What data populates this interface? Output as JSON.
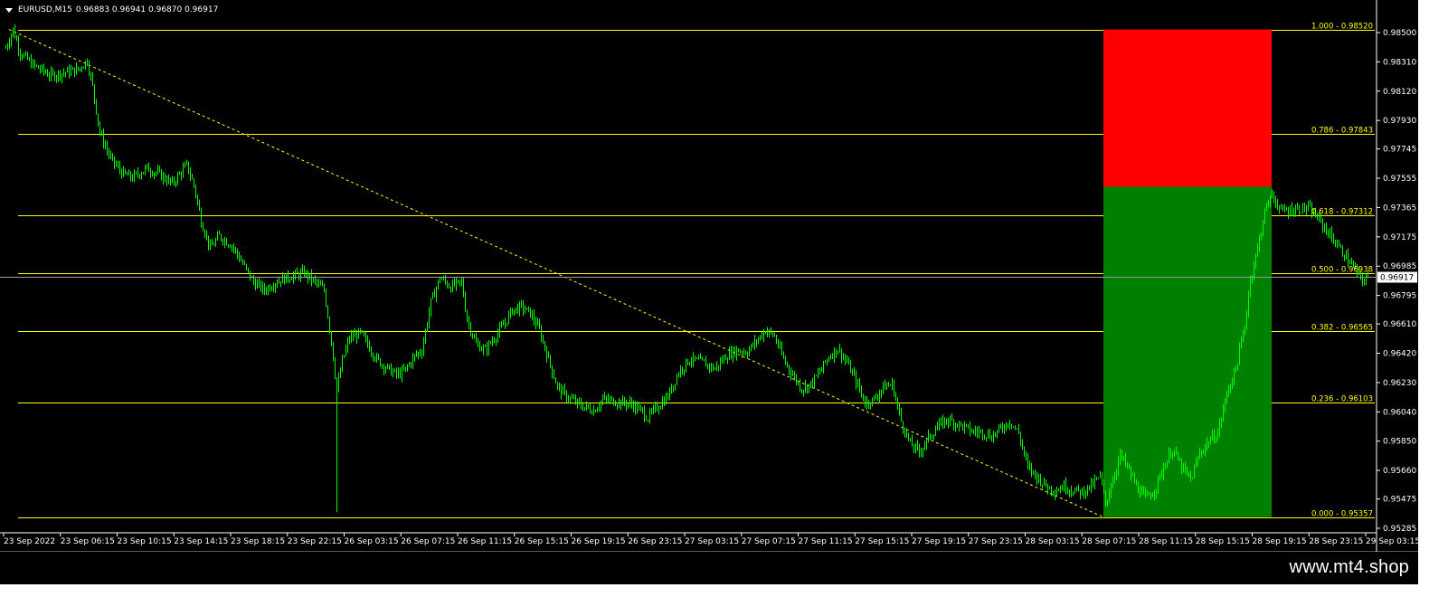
{
  "header": {
    "symbol": "EURUSD,M15",
    "ohlc": "0.96883 0.96941 0.96870 0.96917"
  },
  "watermark": "www.mt4.shop",
  "colors": {
    "background": "#000000",
    "candle": "#00ff00",
    "fib": "#ffff00",
    "stop_zone": "#ff0000",
    "target_zone": "#008000",
    "text": "#ffffff",
    "current_price_bg": "#ffffff"
  },
  "chart_data": {
    "type": "candlestick",
    "symbol": "EURUSD",
    "timeframe": "M15",
    "ylim": [
      0.95285,
      0.985
    ],
    "y_ticks": [
      "0.98500",
      "0.98310",
      "0.98120",
      "0.97930",
      "0.97745",
      "0.97555",
      "0.97365",
      "0.97175",
      "0.96985",
      "0.96795",
      "0.96610",
      "0.96420",
      "0.96230",
      "0.96040",
      "0.95850",
      "0.95660",
      "0.95475",
      "0.95285"
    ],
    "x_ticks": [
      "23 Sep 2022",
      "23 Sep 06:15",
      "23 Sep 10:15",
      "23 Sep 14:15",
      "23 Sep 18:15",
      "23 Sep 22:15",
      "26 Sep 03:15",
      "26 Sep 07:15",
      "26 Sep 11:15",
      "26 Sep 15:15",
      "26 Sep 19:15",
      "26 Sep 23:15",
      "27 Sep 03:15",
      "27 Sep 07:15",
      "27 Sep 11:15",
      "27 Sep 15:15",
      "27 Sep 19:15",
      "27 Sep 23:15",
      "28 Sep 03:15",
      "28 Sep 07:15",
      "28 Sep 11:15",
      "28 Sep 15:15",
      "28 Sep 19:15",
      "28 Sep 23:15",
      "29 Sep 03:15"
    ],
    "current_price": "0.96917",
    "fib_levels": [
      {
        "level": 1.0,
        "price": 0.9852,
        "label": "1.000 - 0.98520"
      },
      {
        "level": 0.786,
        "price": 0.97843,
        "label": "0.786 - 0.97843"
      },
      {
        "level": 0.618,
        "price": 0.97312,
        "label": "0.618 - 0.97312"
      },
      {
        "level": 0.5,
        "price": 0.96938,
        "label": "0.500 - 0.96938"
      },
      {
        "level": 0.382,
        "price": 0.96565,
        "label": "0.382 - 0.96565"
      },
      {
        "level": 0.236,
        "price": 0.96103,
        "label": "0.236 - 0.96103"
      },
      {
        "level": 0.0,
        "price": 0.95357,
        "label": "0.000 - 0.95357"
      }
    ],
    "trendline": {
      "from": {
        "bar": 2,
        "price": 0.9852
      },
      "to": {
        "bar": 607,
        "price": 0.95357
      }
    },
    "stop_zone": {
      "bar_from": 607,
      "bar_to": 700,
      "price_top": 0.9852,
      "price_bottom": 0.975
    },
    "target_zone": {
      "bar_from": 607,
      "bar_to": 700,
      "price_top": 0.975,
      "price_bottom": 0.95357
    },
    "close_path": [
      [
        0,
        0.984
      ],
      [
        4,
        0.9852
      ],
      [
        8,
        0.9837
      ],
      [
        15,
        0.9829
      ],
      [
        25,
        0.9822
      ],
      [
        32,
        0.9824
      ],
      [
        40,
        0.9826
      ],
      [
        45,
        0.9832
      ],
      [
        48,
        0.9815
      ],
      [
        52,
        0.9785
      ],
      [
        58,
        0.9768
      ],
      [
        65,
        0.9758
      ],
      [
        70,
        0.9756
      ],
      [
        78,
        0.9762
      ],
      [
        85,
        0.9758
      ],
      [
        92,
        0.9752
      ],
      [
        100,
        0.9764
      ],
      [
        104,
        0.9751
      ],
      [
        108,
        0.9728
      ],
      [
        113,
        0.971
      ],
      [
        118,
        0.9718
      ],
      [
        125,
        0.9712
      ],
      [
        132,
        0.9698
      ],
      [
        137,
        0.9688
      ],
      [
        143,
        0.9683
      ],
      [
        150,
        0.9689
      ],
      [
        158,
        0.9692
      ],
      [
        165,
        0.9694
      ],
      [
        170,
        0.9689
      ],
      [
        176,
        0.9683
      ],
      [
        180,
        0.965
      ],
      [
        183,
        0.9618
      ],
      [
        186,
        0.9637
      ],
      [
        190,
        0.9652
      ],
      [
        196,
        0.9655
      ],
      [
        200,
        0.9648
      ],
      [
        205,
        0.9638
      ],
      [
        210,
        0.9633
      ],
      [
        216,
        0.9628
      ],
      [
        220,
        0.963
      ],
      [
        226,
        0.964
      ],
      [
        230,
        0.9644
      ],
      [
        235,
        0.9675
      ],
      [
        240,
        0.9691
      ],
      [
        246,
        0.9685
      ],
      [
        252,
        0.9688
      ],
      [
        255,
        0.9664
      ],
      [
        260,
        0.9648
      ],
      [
        265,
        0.9644
      ],
      [
        270,
        0.9652
      ],
      [
        275,
        0.966
      ],
      [
        280,
        0.967
      ],
      [
        285,
        0.9672
      ],
      [
        290,
        0.9668
      ],
      [
        295,
        0.9657
      ],
      [
        300,
        0.9638
      ],
      [
        305,
        0.962
      ],
      [
        310,
        0.9614
      ],
      [
        318,
        0.9608
      ],
      [
        325,
        0.9605
      ],
      [
        330,
        0.9612
      ],
      [
        336,
        0.9611
      ],
      [
        340,
        0.961
      ],
      [
        346,
        0.9609
      ],
      [
        352,
        0.9604
      ],
      [
        355,
        0.96
      ],
      [
        360,
        0.9607
      ],
      [
        366,
        0.9614
      ],
      [
        372,
        0.963
      ],
      [
        378,
        0.9638
      ],
      [
        385,
        0.9636
      ],
      [
        392,
        0.9632
      ],
      [
        398,
        0.964
      ],
      [
        404,
        0.9644
      ],
      [
        410,
        0.9643
      ],
      [
        415,
        0.965
      ],
      [
        420,
        0.9657
      ],
      [
        425,
        0.9653
      ],
      [
        430,
        0.9638
      ],
      [
        435,
        0.9628
      ],
      [
        440,
        0.9619
      ],
      [
        445,
        0.9622
      ],
      [
        450,
        0.963
      ],
      [
        455,
        0.964
      ],
      [
        460,
        0.9645
      ],
      [
        465,
        0.9636
      ],
      [
        470,
        0.9624
      ],
      [
        475,
        0.961
      ],
      [
        480,
        0.9612
      ],
      [
        485,
        0.962
      ],
      [
        490,
        0.9622
      ],
      [
        495,
        0.9598
      ],
      [
        500,
        0.9583
      ],
      [
        505,
        0.9578
      ],
      [
        510,
        0.9587
      ],
      [
        515,
        0.9594
      ],
      [
        520,
        0.9599
      ],
      [
        525,
        0.9597
      ],
      [
        530,
        0.9594
      ],
      [
        535,
        0.9591
      ],
      [
        540,
        0.9591
      ],
      [
        545,
        0.9588
      ],
      [
        550,
        0.9593
      ],
      [
        555,
        0.9598
      ],
      [
        560,
        0.959
      ],
      [
        565,
        0.9568
      ],
      [
        570,
        0.9562
      ],
      [
        575,
        0.9556
      ],
      [
        580,
        0.9553
      ],
      [
        585,
        0.9556
      ],
      [
        590,
        0.9553
      ],
      [
        595,
        0.9552
      ],
      [
        600,
        0.9556
      ],
      [
        605,
        0.9562
      ],
      [
        608,
        0.9545
      ],
      [
        612,
        0.956
      ],
      [
        616,
        0.9576
      ],
      [
        620,
        0.9568
      ],
      [
        625,
        0.9556
      ],
      [
        630,
        0.9548
      ],
      [
        635,
        0.9553
      ],
      [
        640,
        0.9568
      ],
      [
        645,
        0.958
      ],
      [
        650,
        0.9568
      ],
      [
        655,
        0.956
      ],
      [
        660,
        0.9577
      ],
      [
        665,
        0.9585
      ],
      [
        670,
        0.959
      ],
      [
        675,
        0.9616
      ],
      [
        680,
        0.9632
      ],
      [
        685,
        0.966
      ],
      [
        688,
        0.969
      ],
      [
        692,
        0.971
      ],
      [
        696,
        0.9734
      ],
      [
        700,
        0.9745
      ],
      [
        705,
        0.9734
      ],
      [
        710,
        0.9735
      ],
      [
        715,
        0.9736
      ],
      [
        720,
        0.9736
      ],
      [
        725,
        0.973
      ],
      [
        730,
        0.9722
      ],
      [
        735,
        0.9714
      ],
      [
        740,
        0.9706
      ],
      [
        745,
        0.9698
      ],
      [
        750,
        0.9689
      ],
      [
        753,
        0.9692
      ]
    ]
  }
}
